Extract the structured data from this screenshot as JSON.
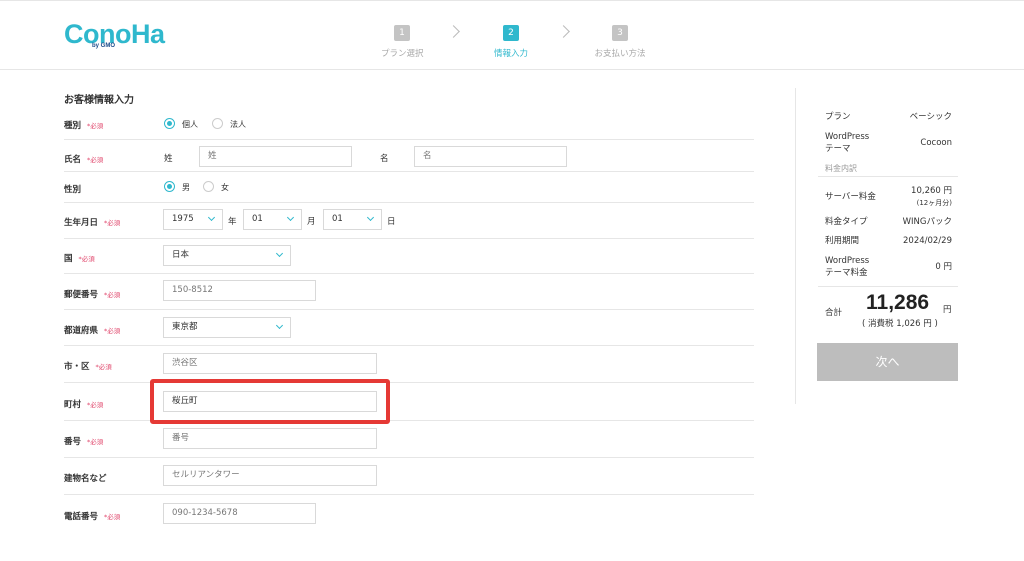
{
  "header": {
    "logo_main": "ConoHa",
    "logo_sub": "by GMO",
    "steps": [
      {
        "num": "1",
        "label": "プラン選択"
      },
      {
        "num": "2",
        "label": "情報入力"
      },
      {
        "num": "3",
        "label": "お支払い方法"
      }
    ],
    "active_step": 2,
    "accent_color": "#2fb8cd"
  },
  "form": {
    "title": "お客様情報入力",
    "required_mark": "*必須",
    "type": {
      "label": "種別",
      "options": [
        "個人",
        "法人"
      ],
      "selected": "個人"
    },
    "name": {
      "label": "氏名",
      "last_label": "姓",
      "last_placeholder": "姓",
      "first_label": "名",
      "first_placeholder": "名"
    },
    "gender": {
      "label": "性別",
      "options": [
        "男",
        "女"
      ],
      "selected": "男"
    },
    "birth": {
      "label": "生年月日",
      "year": "1975",
      "year_unit": "年",
      "month": "01",
      "month_unit": "月",
      "day": "01",
      "day_unit": "日"
    },
    "country": {
      "label": "国",
      "value": "日本"
    },
    "zip": {
      "label": "郵便番号",
      "placeholder": "150-8512"
    },
    "prefecture": {
      "label": "都道府県",
      "value": "東京都"
    },
    "city": {
      "label": "市・区",
      "placeholder": "渋谷区"
    },
    "town": {
      "label": "町村",
      "value": "桜丘町"
    },
    "number": {
      "label": "番号",
      "placeholder": "番号"
    },
    "building": {
      "label": "建物名など",
      "placeholder": "セルリアンタワー"
    },
    "phone": {
      "label": "電話番号",
      "placeholder": "090-1234-5678"
    }
  },
  "summary": {
    "plan_label": "プラン",
    "plan_value": "ベーシック",
    "theme_label_1": "WordPress",
    "theme_label_2": "テーマ",
    "theme_value": "Cocoon",
    "breakdown_label": "料金内訳",
    "server_fee_label": "サーバー料金",
    "server_fee_value": "10,260 円",
    "server_fee_note": "(12ヶ月分)",
    "fee_type_label": "料金タイプ",
    "fee_type_value": "WINGパック",
    "period_label": "利用期間",
    "period_value": "2024/02/29",
    "theme_fee_label_1": "WordPress",
    "theme_fee_label_2": "テーマ料金",
    "theme_fee_value": "0 円",
    "total_label": "合計",
    "total_amount": "11,286",
    "total_unit": "円",
    "total_tax": "( 消費税 1,026 円 )",
    "next_button": "次へ"
  }
}
